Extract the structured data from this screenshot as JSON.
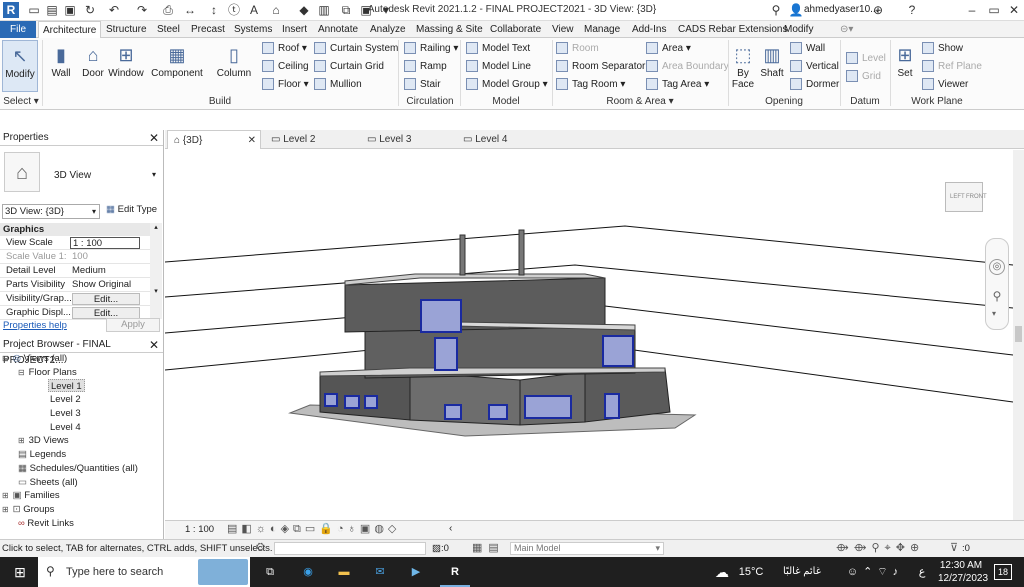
{
  "title": "Autodesk Revit 2021.1.2 - FINAL PROJECT2021 - 3D View: {3D}",
  "user": "ahmedyaser10...",
  "ribbon_tabs": [
    "File",
    "Architecture",
    "Structure",
    "Steel",
    "Precast",
    "Systems",
    "Insert",
    "Annotate",
    "Analyze",
    "Massing & Site",
    "Collaborate",
    "View",
    "Manage",
    "Add-Ins",
    "CADS Rebar Extensions",
    "Modify"
  ],
  "ribbon": {
    "modify": "Modify",
    "select": "Select",
    "wall": "Wall",
    "door": "Door",
    "window": "Window",
    "component": "Component",
    "column": "Column",
    "roof": "Roof",
    "ceiling": "Ceiling",
    "floor": "Floor",
    "curtain_system": "Curtain System",
    "curtain_grid": "Curtain Grid",
    "mullion": "Mullion",
    "railing": "Railing",
    "ramp": "Ramp",
    "stair": "Stair",
    "model_text": "Model Text",
    "model_line": "Model Line",
    "model_group": "Model Group",
    "room": "Room",
    "room_separator": "Room Separator",
    "tag_room": "Tag Room",
    "area": "Area",
    "area_boundary": "Area Boundary",
    "tag_area": "Tag Area",
    "by_face": "By Face",
    "shaft": "Shaft",
    "wall_op": "Wall",
    "vertical": "Vertical",
    "dormer": "Dormer",
    "level": "Level",
    "grid": "Grid",
    "set": "Set",
    "show": "Show",
    "ref_plane": "Ref Plane",
    "viewer": "Viewer",
    "panels": {
      "build": "Build",
      "circulation": "Circulation",
      "model": "Model",
      "room_area": "Room & Area",
      "opening": "Opening",
      "datum": "Datum",
      "work_plane": "Work Plane"
    }
  },
  "properties": {
    "header": "Properties",
    "type": "3D View",
    "selector": "3D View: {3D}",
    "edit_type": "Edit Type",
    "section": "Graphics",
    "rows": [
      {
        "k": "View Scale",
        "v": "1 : 100"
      },
      {
        "k": "Scale Value    1:",
        "v": "100"
      },
      {
        "k": "Detail Level",
        "v": "Medium"
      },
      {
        "k": "Parts Visibility",
        "v": "Show Original"
      },
      {
        "k": "Visibility/Grap...",
        "v": "Edit..."
      },
      {
        "k": "Graphic Displ...",
        "v": "Edit..."
      }
    ],
    "help": "Properties help",
    "apply": "Apply"
  },
  "browser": {
    "header": "Project Browser - FINAL PROJECT2...",
    "views": "Views (all)",
    "floor_plans": "Floor Plans",
    "levels": [
      "Level 1",
      "Level 2",
      "Level 3",
      "Level 4"
    ],
    "three_d": "3D Views",
    "legends": "Legends",
    "schedules": "Schedules/Quantities (all)",
    "sheets": "Sheets (all)",
    "families": "Families",
    "groups": "Groups",
    "links": "Revit Links"
  },
  "view_tabs": [
    "{3D}",
    "Level 2",
    "Level 3",
    "Level 4"
  ],
  "viewcube": {
    "left": "LEFT",
    "front": "FRONT"
  },
  "view_scale": "1 : 100",
  "status": {
    "hint": "Click to select, TAB for alternates, CTRL adds, SHIFT unselects.",
    "filter": ":0",
    "model": "Main Model",
    "filter2": ":0"
  },
  "taskbar": {
    "search": "Type here to search",
    "weather": "15°C",
    "weather_note": "غائم غالبًا",
    "lang": "ع",
    "time": "12:30 AM",
    "date": "12/27/2023",
    "notif": "18"
  }
}
